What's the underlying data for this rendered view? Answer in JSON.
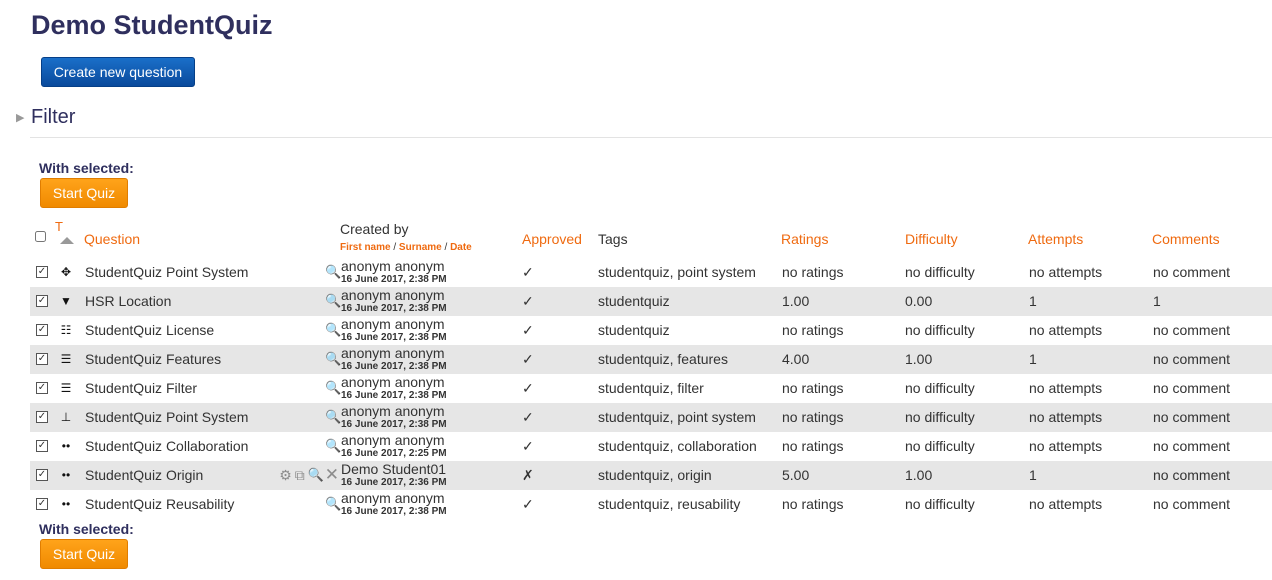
{
  "page": {
    "title": "Demo StudentQuiz"
  },
  "actions": {
    "create_label": "Create new question"
  },
  "filter": {
    "toggle": "▶",
    "label": "Filter"
  },
  "bulk": {
    "with_selected": "With selected:",
    "start_label": "Start Quiz"
  },
  "table": {
    "sort_letter": "T",
    "headers": {
      "question": "Question",
      "created_by": "Created by",
      "created_by_sort": {
        "first": "First name",
        "surname": "Surname",
        "date": "Date",
        "sep": " / "
      },
      "approved": "Approved",
      "tags": "Tags",
      "ratings": "Ratings",
      "difficulty": "Difficulty",
      "attempts": "Attempts",
      "comments": "Comments"
    },
    "rows": [
      {
        "checked": "✓",
        "icon": "✥",
        "icon_name": "drag-drop-icon",
        "name": "StudentQuiz Point System",
        "creator": "anonym anonym",
        "date": "16 June 2017, 2:38 PM",
        "approved": "✓",
        "tags": "studentquiz, point system",
        "ratings": "no ratings",
        "difficulty": "no difficulty",
        "attempts": "no attempts",
        "comments": "no comment",
        "extra_actions": false
      },
      {
        "checked": "✓",
        "icon": "▼",
        "icon_name": "dropdown-icon",
        "name": "HSR Location",
        "creator": "anonym anonym",
        "date": "16 June 2017, 2:38 PM",
        "approved": "✓",
        "tags": "studentquiz",
        "ratings": "1.00",
        "difficulty": "0.00",
        "attempts": "1",
        "comments": "1",
        "extra_actions": false
      },
      {
        "checked": "✓",
        "icon": "☷",
        "icon_name": "matching-icon",
        "name": "StudentQuiz License",
        "creator": "anonym anonym",
        "date": "16 June 2017, 2:38 PM",
        "approved": "✓",
        "tags": "studentquiz",
        "ratings": "no ratings",
        "difficulty": "no difficulty",
        "attempts": "no attempts",
        "comments": "no comment",
        "extra_actions": false
      },
      {
        "checked": "✓",
        "icon": "☰",
        "icon_name": "multichoice-icon",
        "name": "StudentQuiz Features",
        "creator": "anonym anonym",
        "date": "16 June 2017, 2:38 PM",
        "approved": "✓",
        "tags": "studentquiz, features",
        "ratings": "4.00",
        "difficulty": "1.00",
        "attempts": "1",
        "comments": "no comment",
        "extra_actions": false
      },
      {
        "checked": "✓",
        "icon": "☰",
        "icon_name": "multichoice-icon",
        "name": "StudentQuiz Filter",
        "creator": "anonym anonym",
        "date": "16 June 2017, 2:38 PM",
        "approved": "✓",
        "tags": "studentquiz, filter",
        "ratings": "no ratings",
        "difficulty": "no difficulty",
        "attempts": "no attempts",
        "comments": "no comment",
        "extra_actions": false
      },
      {
        "checked": "✓",
        "icon": "⊥",
        "icon_name": "numerical-icon",
        "name": "StudentQuiz Point System",
        "creator": "anonym anonym",
        "date": "16 June 2017, 2:38 PM",
        "approved": "✓",
        "tags": "studentquiz, point system",
        "ratings": "no ratings",
        "difficulty": "no difficulty",
        "attempts": "no attempts",
        "comments": "no comment",
        "extra_actions": false
      },
      {
        "checked": "✓",
        "icon": "••",
        "icon_name": "truefalse-icon",
        "name": "StudentQuiz Collaboration",
        "creator": "anonym anonym",
        "date": "16 June 2017, 2:25 PM",
        "approved": "✓",
        "tags": "studentquiz, collaboration",
        "ratings": "no ratings",
        "difficulty": "no difficulty",
        "attempts": "no attempts",
        "comments": "no comment",
        "extra_actions": false
      },
      {
        "checked": "✓",
        "icon": "••",
        "icon_name": "truefalse-icon",
        "name": "StudentQuiz Origin",
        "creator": "Demo Student01",
        "date": "16 June 2017, 2:36 PM",
        "approved": "✗",
        "tags": "studentquiz, origin",
        "ratings": "5.00",
        "difficulty": "1.00",
        "attempts": "1",
        "comments": "no comment",
        "extra_actions": true
      },
      {
        "checked": "✓",
        "icon": "••",
        "icon_name": "truefalse-icon",
        "name": "StudentQuiz Reusability",
        "creator": "anonym anonym",
        "date": "16 June 2017, 2:38 PM",
        "approved": "✓",
        "tags": "studentquiz, reusability",
        "ratings": "no ratings",
        "difficulty": "no difficulty",
        "attempts": "no attempts",
        "comments": "no comment",
        "extra_actions": false
      }
    ],
    "row_action_icons": {
      "edit": "⚙",
      "duplicate": "⧉",
      "preview": "🔍",
      "delete": "✕"
    }
  },
  "colors": {
    "title": "#2f2f5e",
    "accent_orange": "#ef6a10",
    "primary_button": "#0a4a9c",
    "start_button": "#f7941d",
    "alt_row": "#e6e6e6"
  }
}
